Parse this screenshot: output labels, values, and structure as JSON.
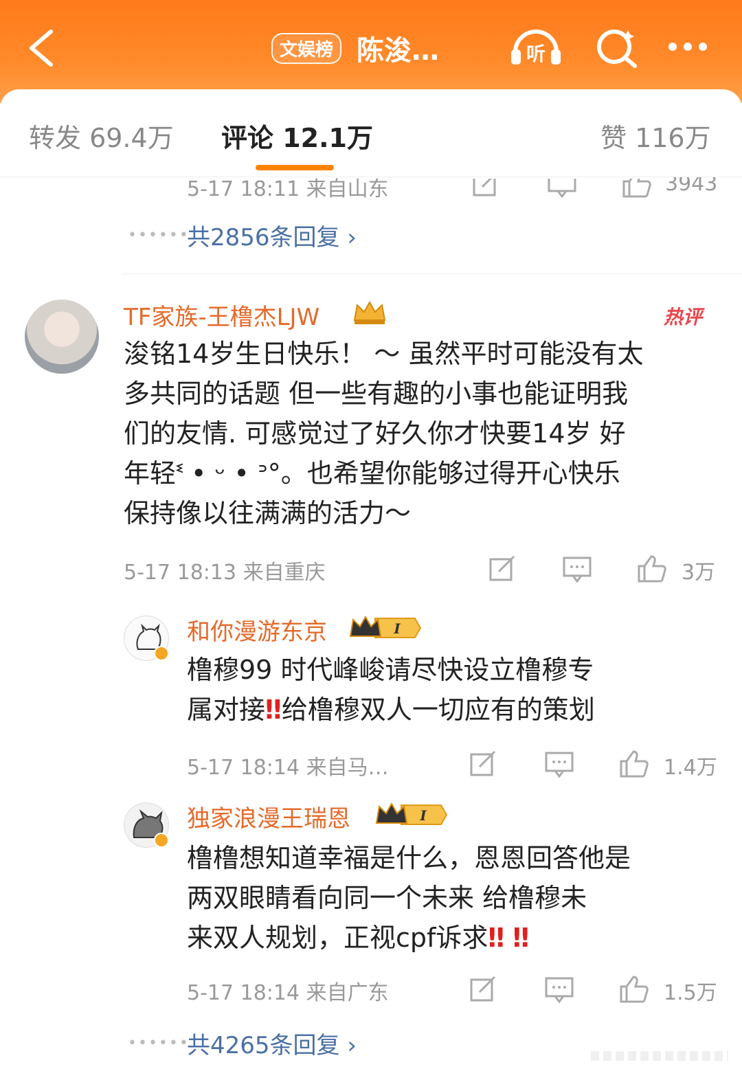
{
  "header": {
    "tag": "文娱榜",
    "title": "陈浚…",
    "listen_label": "听"
  },
  "tabs": [
    {
      "label": "转发 69.4万"
    },
    {
      "label": "评论 12.1万"
    },
    {
      "label": "赞 116万"
    }
  ],
  "prev_comment": {
    "meta": "5-17 18:11 来自山东",
    "likes": "3943",
    "replies_link": "共2856条回复"
  },
  "comment": {
    "username": "TF家族-王橹杰LJW",
    "hot_label": "热评",
    "text_lines": [
      "浚铭14岁生日快乐！ ～  虽然平时可能没有太",
      "多共同的话题 但一些有趣的小事也能证明我",
      "们的友情. 可感觉过了好久你才快要14岁  好",
      "年轻ᓫ • ᵕ • ᐣ°。也希望你能够过得开心快乐",
      "保持像以往满满的活力～"
    ],
    "meta": "5-17 18:13 来自重庆",
    "likes": "3万",
    "replies_link": "共4265条回复"
  },
  "replies": [
    {
      "username": "和你漫游东京",
      "level": "I",
      "text_lines": [
        "橹穆99        时代峰峻请尽快设立橹穆专",
        "属对接",
        "给橹穆双人一切应有的策划"
      ],
      "meta": "5-17 18:14 来自马…",
      "likes": "1.4万"
    },
    {
      "username": "独家浪漫王瑞恩",
      "level": "I",
      "text_lines": [
        "橹橹想知道幸福是什么，恩恩回答他是",
        "两双眼睛看向同一个未来        给橹穆未",
        "来双人规划，正视cpf诉求"
      ],
      "meta": "5-17 18:14 来自广东",
      "likes": "1.5万"
    }
  ],
  "marks": {
    "double_exclaim": "‼"
  }
}
